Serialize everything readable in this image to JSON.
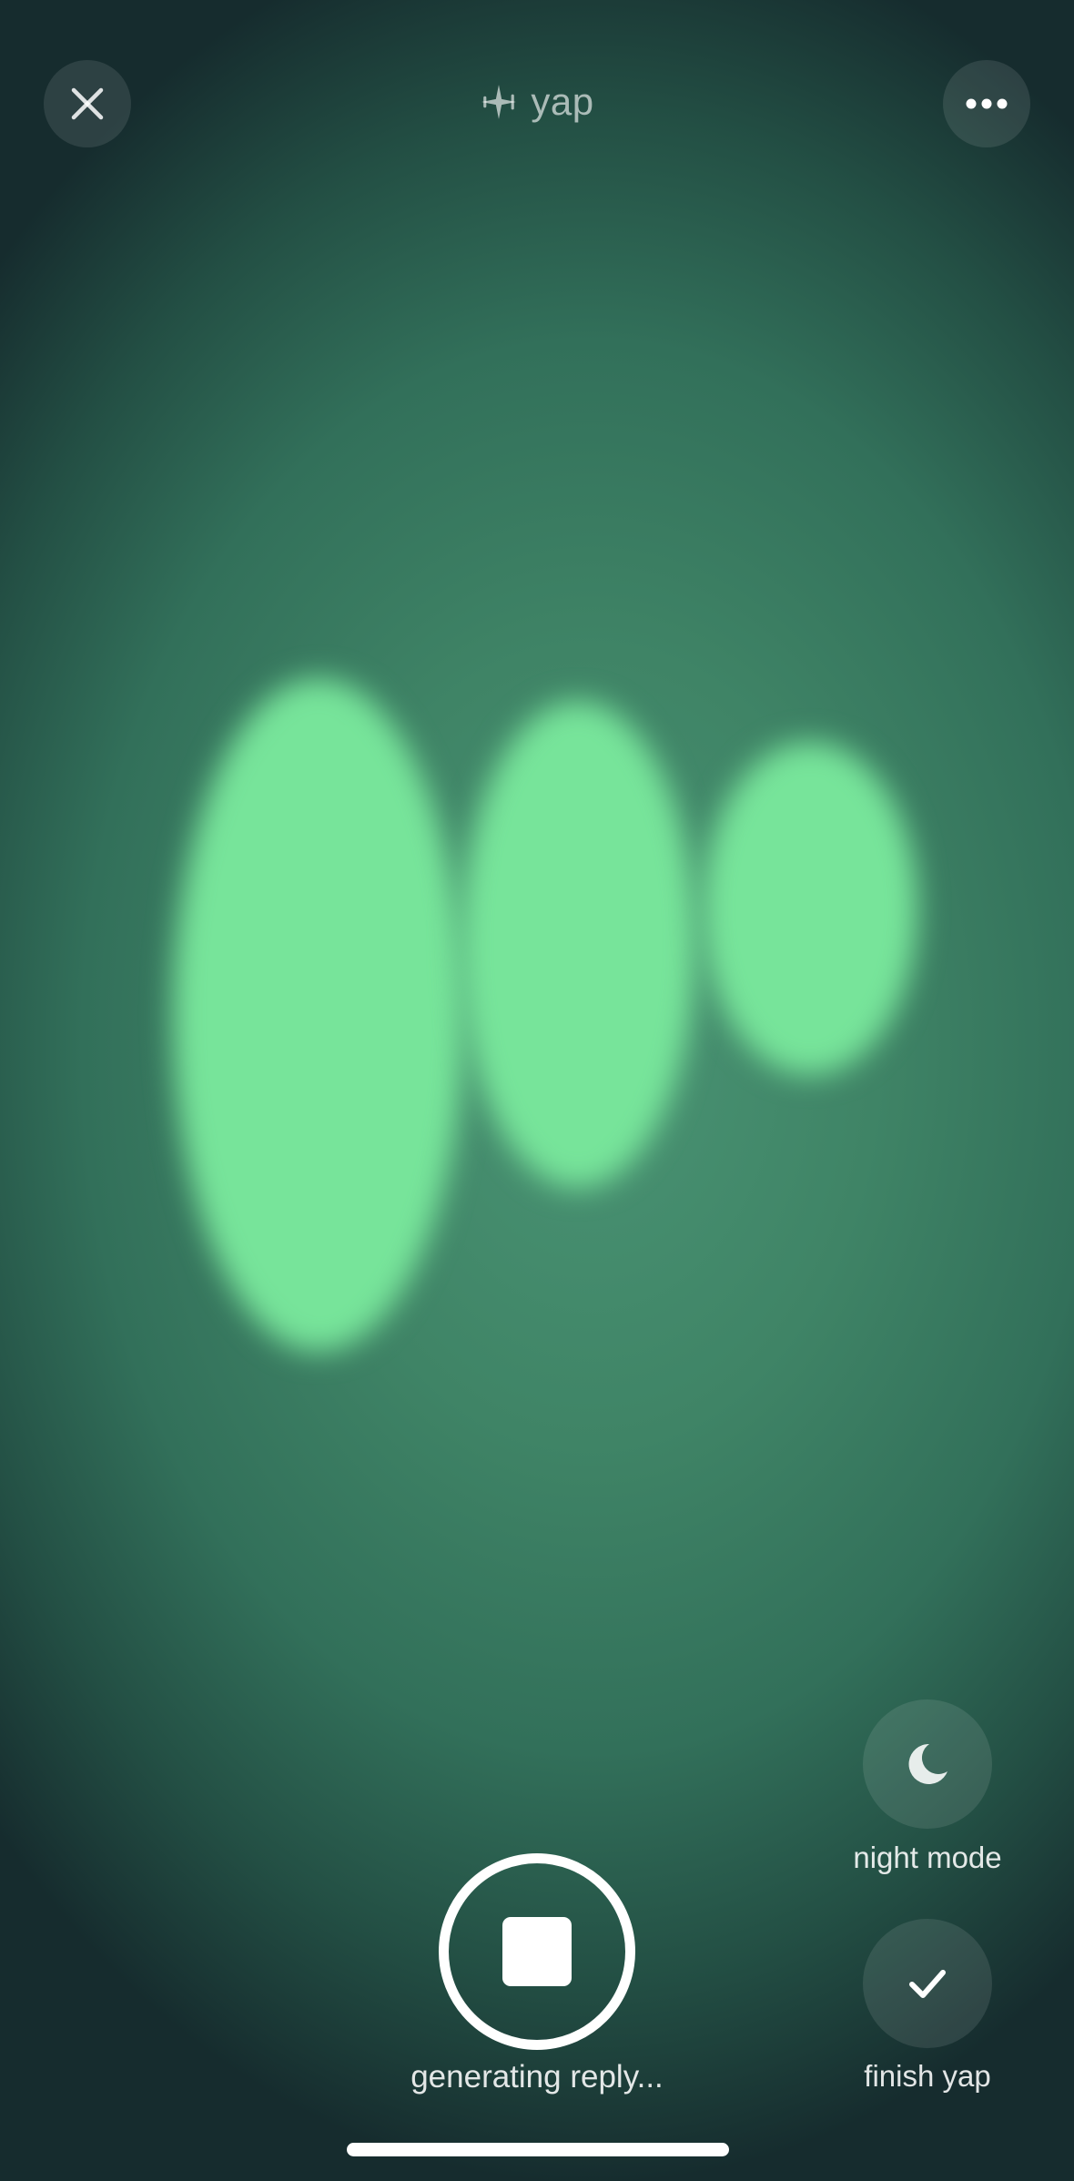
{
  "header": {
    "title": "yap",
    "close_icon": "close-icon",
    "logo_icon": "waveform-sparkle-icon",
    "more_icon": "more-horizontal-icon"
  },
  "visualizer": {
    "blob_color": "#77e49a",
    "background_color": "#3f8466"
  },
  "controls": {
    "night_mode_label": "night mode",
    "night_mode_icon": "moon-icon",
    "finish_label": "finish yap",
    "finish_icon": "checkmark-icon",
    "stop_icon": "stop-icon",
    "status": "generating reply..."
  }
}
